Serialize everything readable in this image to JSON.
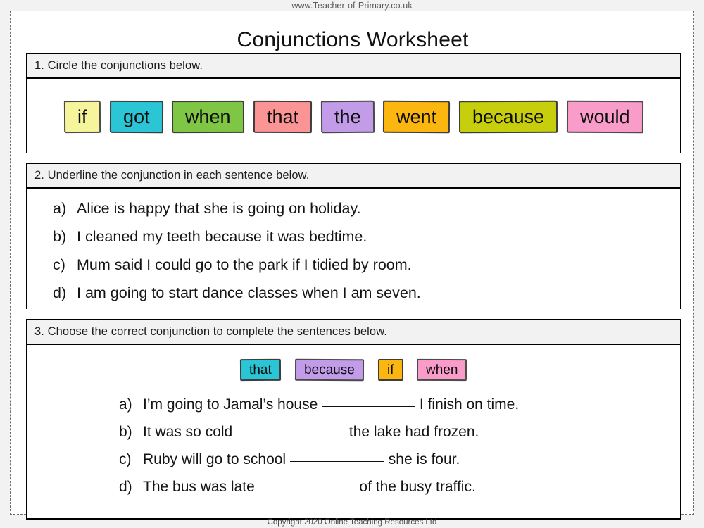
{
  "meta": {
    "site_url": "www.Teacher-of-Primary.co.uk",
    "copyright": "Copyright 2020 Online Teaching Resources Ltd"
  },
  "title": "Conjunctions Worksheet",
  "tasks": [
    {
      "number": "1.",
      "heading": "1.  Circle the conjunctions below.",
      "words": [
        {
          "text": "if",
          "color": "#f7f59b",
          "border": "#4a4a4a"
        },
        {
          "text": "got",
          "color": "#2ac6d6",
          "border": "#3c3c3c"
        },
        {
          "text": "when",
          "color": "#7fc644",
          "border": "#3c3c3c"
        },
        {
          "text": "that",
          "color": "#fb9494",
          "border": "#3c3c3c"
        },
        {
          "text": "the",
          "color": "#c29ce9",
          "border": "#4a4a4a"
        },
        {
          "text": "went",
          "color": "#fbb70f",
          "border": "#3c3c3c"
        },
        {
          "text": "because",
          "color": "#c7ce0b",
          "border": "#3c3c3c"
        },
        {
          "text": "would",
          "color": "#fa9cc9",
          "border": "#4a4a4a"
        }
      ]
    },
    {
      "number": "2.",
      "heading": "2. Underline the conjunction in each sentence below.",
      "sentences": [
        {
          "marker": "a)",
          "text": "Alice is happy that she is going on holiday."
        },
        {
          "marker": "b)",
          "text": "I cleaned my teeth because it was bedtime."
        },
        {
          "marker": "c)",
          "text": "Mum said I could go to the park if I tidied by room."
        },
        {
          "marker": "d)",
          "text": "I am going to start dance classes when I am seven."
        }
      ]
    },
    {
      "number": "3.",
      "heading": "3.   Choose the correct conjunction to complete the sentences below.",
      "words": [
        {
          "text": "that",
          "color": "#2ac6d6",
          "border": "#3c3c3c"
        },
        {
          "text": "because",
          "color": "#c29ce9",
          "border": "#4a4a4a"
        },
        {
          "text": "if",
          "color": "#fbb70f",
          "border": "#3c3c3c"
        },
        {
          "text": "when",
          "color": "#fa9cc9",
          "border": "#4a4a4a"
        }
      ],
      "sentences": [
        {
          "marker": "a)",
          "before": "I’m going to Jamal’s house ",
          "after": " I finish on time."
        },
        {
          "marker": "b)",
          "before": "It was so cold ",
          "after": " the lake had frozen."
        },
        {
          "marker": "c)",
          "before": "Ruby will go to school ",
          "after": " she is four."
        },
        {
          "marker": "d)",
          "before": "The bus was late ",
          "after": " of the busy traffic."
        }
      ]
    }
  ]
}
